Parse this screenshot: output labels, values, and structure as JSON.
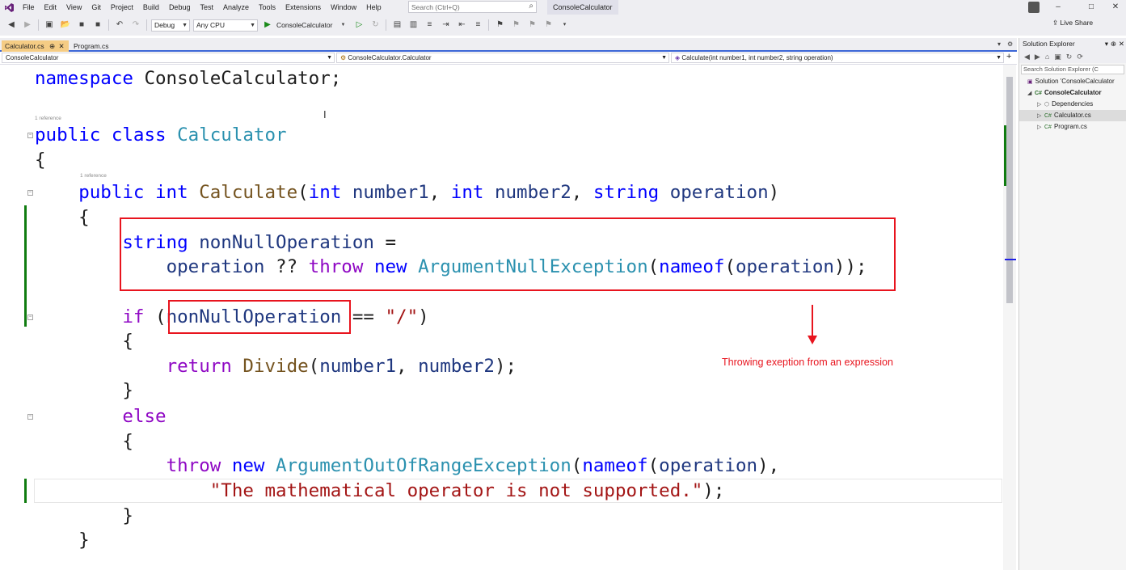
{
  "menu": {
    "items": [
      "File",
      "Edit",
      "View",
      "Git",
      "Project",
      "Build",
      "Debug",
      "Test",
      "Analyze",
      "Tools",
      "Extensions",
      "Window",
      "Help"
    ],
    "search_placeholder": "Search (Ctrl+Q)",
    "solution_name": "ConsoleCalculator"
  },
  "toolbar": {
    "configuration": "Debug",
    "platform": "Any CPU",
    "run_target": "ConsoleCalculator",
    "live_share": "Live Share"
  },
  "tabs": [
    {
      "label": "Calculator.cs",
      "active": true
    },
    {
      "label": "Program.cs",
      "active": false
    }
  ],
  "navbar": {
    "project": "ConsoleCalculator",
    "type": "ConsoleCalculator.Calculator",
    "member": "Calculate(int number1, int number2, string operation)"
  },
  "code": {
    "codelens_class": "1 reference",
    "codelens_method": "1 reference"
  },
  "annotation": {
    "text": "Throwing exeption from an expression",
    "color": "#e8141e"
  },
  "solution_explorer": {
    "title": "Solution Explorer",
    "search_placeholder": "Search Solution Explorer (C",
    "solution": "Solution 'ConsoleCalculator",
    "project": "ConsoleCalculator",
    "items": [
      "Dependencies",
      "Calculator.cs",
      "Program.cs"
    ]
  }
}
